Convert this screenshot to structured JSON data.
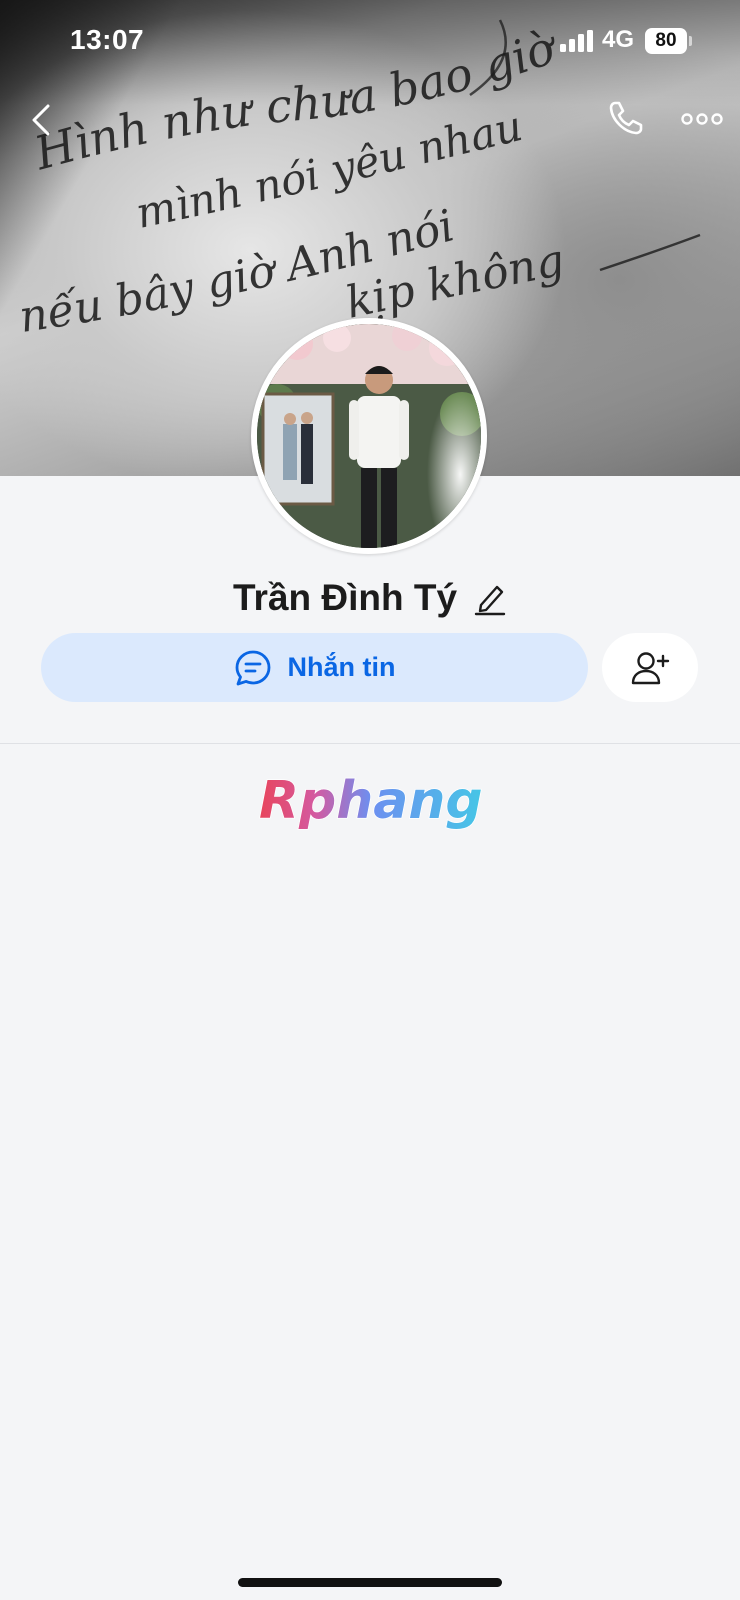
{
  "status_bar": {
    "time": "13:07",
    "network": "4G",
    "battery": "80"
  },
  "cover": {
    "handwriting": [
      "Hình như chưa bao giờ",
      "mình nói yêu nhau",
      "nếu bây giờ Anh nói",
      "kịp không"
    ]
  },
  "nav": {
    "back_icon": "chevron-left-icon",
    "call_icon": "phone-icon",
    "more_icon": "more-dots-icon"
  },
  "profile": {
    "name": "Trần Đình Tý",
    "edit_icon": "pencil-icon"
  },
  "actions": {
    "message_label": "Nhắn tin",
    "message_icon": "chat-bubble-icon",
    "add_friend_icon": "add-user-icon"
  },
  "watermark": {
    "text": "Rphang"
  },
  "colors": {
    "accent": "#0a66e4",
    "message_button_bg": "#dbe9fd",
    "page_bg": "#f4f5f7"
  }
}
